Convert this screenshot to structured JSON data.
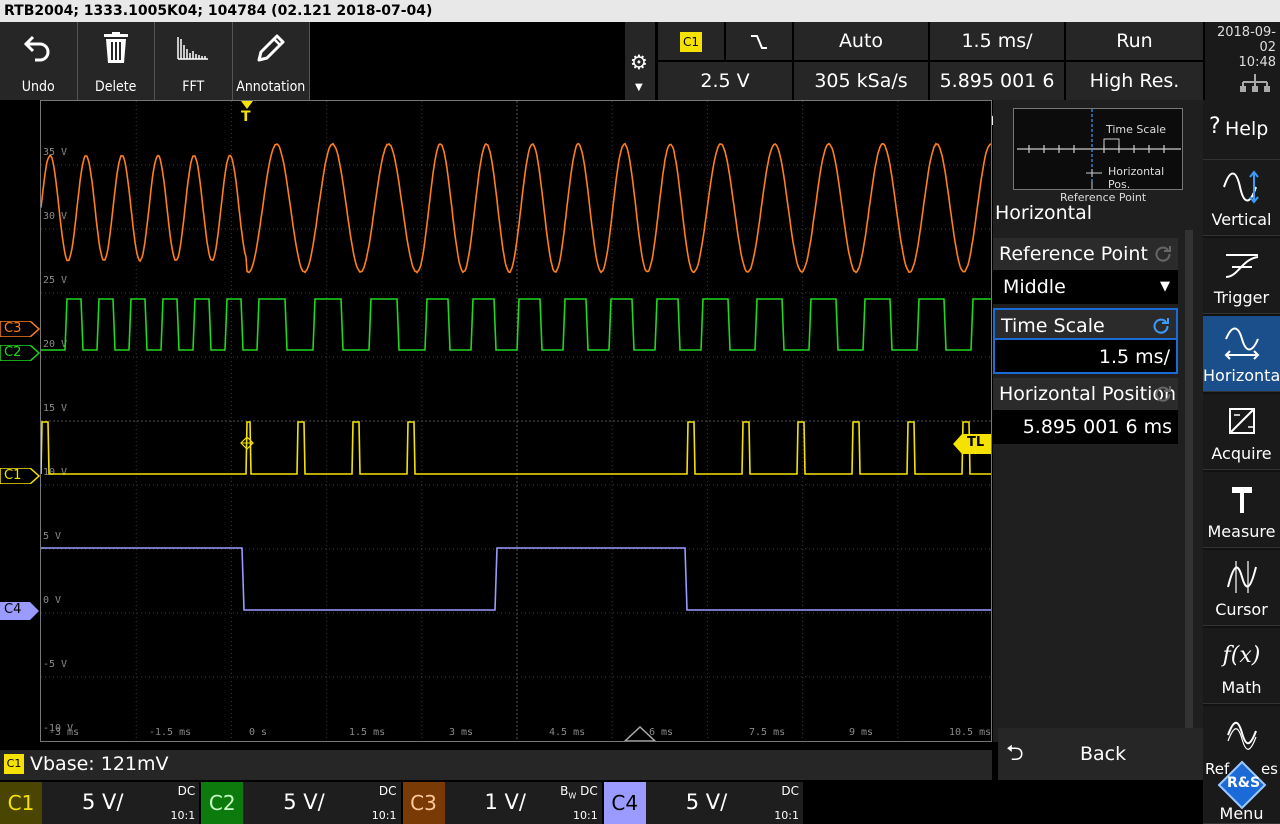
{
  "title_bar": {
    "text": "RTB2004; 1333.1005K04; 104784 (02.121 2018-07-04)"
  },
  "toolbar": {
    "undo": "Undo",
    "delete": "Delete",
    "fft": "FFT",
    "annotation": "Annotation"
  },
  "status": {
    "trigger_source": "C1",
    "trigger_level": "2.5 V",
    "trigger_mode": "Auto",
    "sample_rate": "305 kSa/s",
    "time_scale": "1.5 ms/",
    "horizontal_position": "5.895 001 6 ms",
    "run_state": "Run",
    "acq_mode": "High Res.",
    "date": "2018-09-02",
    "time": "10:48"
  },
  "colors": {
    "c1": "#f5e200",
    "c2": "#1fd81f",
    "c3": "#ff7f1a",
    "c4": "#9a9aff",
    "accent": "#1a4f8c"
  },
  "scope": {
    "y_labels": [
      "35 V",
      "30 V",
      "25 V",
      "20 V",
      "15 V",
      "10 V",
      "5 V",
      "0 V",
      "-5 V",
      "-10 V"
    ],
    "x_labels": [
      "-3 ms",
      "-1.5 ms",
      "0 s",
      "1.5 ms",
      "3 ms",
      "4.5 ms",
      "6 ms",
      "7.5 ms",
      "9 ms",
      "10.5 ms"
    ],
    "trigger_marker": "T",
    "trigger_level_tag": "TL",
    "channel_tags": [
      "C3",
      "C2",
      "C1",
      "C4"
    ]
  },
  "vbase": {
    "channel": "C1",
    "text": "Vbase: 121mV"
  },
  "channels": [
    {
      "name": "C1",
      "scale": "5 V/",
      "coupling": "DC",
      "probe": "10:1"
    },
    {
      "name": "C2",
      "scale": "5 V/",
      "coupling": "DC",
      "probe": "10:1"
    },
    {
      "name": "C3",
      "scale": "1 V/",
      "coupling": "DC",
      "bw": "B",
      "bw_sub": "W",
      "probe": "10:1"
    },
    {
      "name": "C4",
      "scale": "5 V/",
      "coupling": "DC",
      "probe": "10:1"
    }
  ],
  "panel": {
    "title": "Horizontal",
    "diagram": {
      "time_scale": "Time Scale",
      "horizontal_pos": "Horizontal Pos.",
      "ref_point": "Reference Point"
    },
    "reference_point_label": "Reference Point",
    "reference_point_value": "Middle",
    "time_scale_label": "Time Scale",
    "time_scale_value": "1.5 ms/",
    "horizontal_position_label": "Horizontal Position",
    "horizontal_position_value": "5.895 001 6 ms",
    "back": "Back"
  },
  "side_menu": {
    "help": "Help",
    "vertical": "Vertical",
    "trigger": "Trigger",
    "horizontal": "Horizontal",
    "acquire": "Acquire",
    "measure": "Measure",
    "cursor": "Cursor",
    "math": "Math",
    "ref": "Ref",
    "ref_tail": "es",
    "menu": "Menu",
    "logo": "R&S"
  }
}
